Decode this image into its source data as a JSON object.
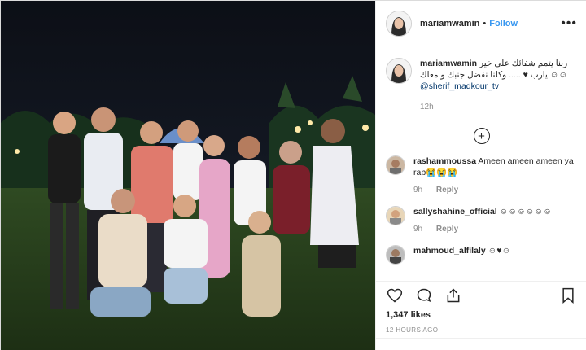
{
  "post": {
    "username": "mariamwamin",
    "separator": "•",
    "follow_label": "Follow",
    "more_icon": "more-dots-icon"
  },
  "caption": {
    "username": "mariamwamin",
    "text": "ربنا يتمم شفائك على خير يارب ♥ ..... وكلنا نفضل جنبك و معاك ☺☺",
    "mention": "@sherif_madkour_tv",
    "time": "12h"
  },
  "load_more_icon": "plus-circle-icon",
  "comments": [
    {
      "username": "rashammoussa",
      "text": "Ameen ameen ameen ya rab😭😭😭",
      "time": "9h",
      "reply": "Reply"
    },
    {
      "username": "sallyshahine_official",
      "text": "☺☺☺☺☺☺",
      "time": "9h",
      "reply": "Reply"
    },
    {
      "username": "mahmoud_alfilaly",
      "text": "☺♥☺",
      "time": "",
      "reply": ""
    }
  ],
  "likes": "1,347 likes",
  "posted_ago": "12 HOURS AGO",
  "icons": {
    "like": "heart-icon",
    "comment": "comment-icon",
    "share": "share-icon",
    "save": "bookmark-icon"
  },
  "colors": {
    "link_blue": "#3897f0",
    "mention": "#003569",
    "muted": "#8e8e8e",
    "border": "#efefef"
  }
}
